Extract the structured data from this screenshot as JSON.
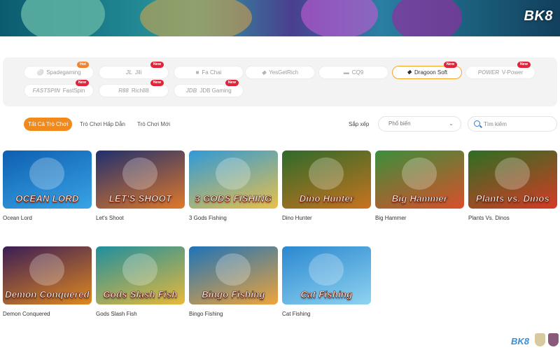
{
  "banner": {
    "logo": "BK8"
  },
  "providers": [
    {
      "logo": "",
      "label": "Spadegaming",
      "badge": "Hot",
      "active": false
    },
    {
      "logo": "JL",
      "label": "Jili",
      "badge": "New",
      "active": false
    },
    {
      "logo": "",
      "label": "Fa Chai",
      "badge": "",
      "active": false
    },
    {
      "logo": "",
      "label": "YesGetRich",
      "badge": "",
      "active": false
    },
    {
      "logo": "",
      "label": "CQ9",
      "badge": "",
      "active": false
    },
    {
      "logo": "",
      "label": "Dragoon Soft",
      "badge": "New",
      "active": true
    },
    {
      "logo": "POWER",
      "label": "V-Power",
      "badge": "New",
      "active": false
    },
    {
      "logo": "FASTSPIN",
      "label": "FastSpin",
      "badge": "New",
      "active": false
    },
    {
      "logo": "R88",
      "label": "Rich88",
      "badge": "New",
      "active": false
    },
    {
      "logo": "JDB",
      "label": "JDB Gaming",
      "badge": "New",
      "active": false
    }
  ],
  "tabs": [
    {
      "label": "Tất Cả Trò Chơi",
      "active": true
    },
    {
      "label": "Trò Chơi Hấp Dẫn",
      "active": false
    },
    {
      "label": "Trò Chơi Mới",
      "active": false
    }
  ],
  "sort": {
    "label": "Sắp xếp",
    "selected": "Phổ biến"
  },
  "search": {
    "placeholder": "Tìm kiếm"
  },
  "games": [
    {
      "name": "Ocean Lord",
      "art_title": "OCEAN LORD",
      "colors": [
        "#0e5fb0",
        "#39a4e6"
      ]
    },
    {
      "name": "Let's Shoot",
      "art_title": "LET'S SHOOT",
      "colors": [
        "#1f2f6e",
        "#e0792a"
      ]
    },
    {
      "name": "3 Gods Fishing",
      "art_title": "3 GODS FISHING",
      "colors": [
        "#2f9ad8",
        "#e8c04a"
      ]
    },
    {
      "name": "Dino Hunter",
      "art_title": "Dino Hunter",
      "colors": [
        "#2d6b2a",
        "#c9731f"
      ]
    },
    {
      "name": "Big Hammer",
      "art_title": "Big Hammer",
      "colors": [
        "#3b8f3c",
        "#d94f2a"
      ]
    },
    {
      "name": "Plants Vs. Dinos",
      "art_title": "Plants vs. Dinos",
      "colors": [
        "#2c6f22",
        "#d63a26"
      ]
    },
    {
      "name": "Demon Conquered",
      "art_title": "Demon Conquered",
      "colors": [
        "#3a1d55",
        "#e0881f"
      ]
    },
    {
      "name": "Gods Slash Fish",
      "art_title": "Gods Slash Fish",
      "colors": [
        "#1f8f9e",
        "#e8b93a"
      ]
    },
    {
      "name": "Bingo Fishing",
      "art_title": "Bingo Fishing",
      "colors": [
        "#1d73b8",
        "#f0a43a"
      ]
    },
    {
      "name": "Cat Fishing",
      "art_title": "Cat Fishing",
      "colors": [
        "#2a88d0",
        "#8fd3f0"
      ]
    }
  ],
  "footer": {
    "logo": "BK8"
  }
}
